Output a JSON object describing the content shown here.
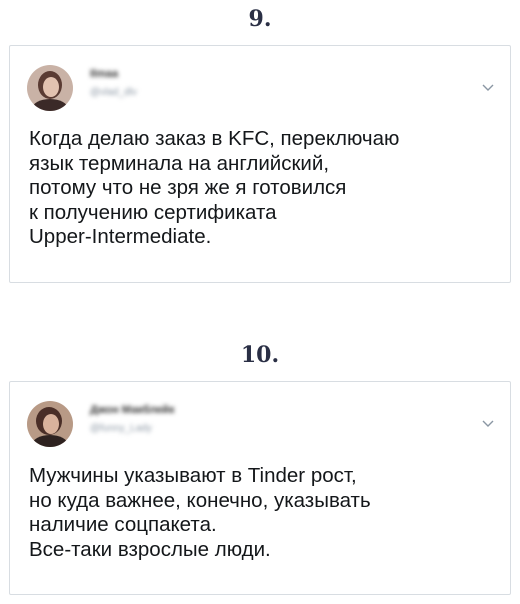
{
  "tweets": [
    {
      "number": "9.",
      "name": "Ilmaa",
      "handle": "@vlad_dlv",
      "lines": [
        "Когда делаю заказ в KFC, переключаю",
        "язык терминала на английский,",
        "потому что не зря же я готовился",
        "к получению сертификата",
        "Upper-Intermediate."
      ]
    },
    {
      "number": "10.",
      "name": "Джон Макблейк",
      "handle": "@funny_Lady",
      "lines": [
        "Мужчины указывают в Tinder рост,",
        "но куда важнее, конечно, указывать",
        "наличие соцпакета.",
        "Все-таки взрослые люди."
      ]
    }
  ],
  "icons": {
    "options": "chevron-down-icon",
    "avatar": "avatar"
  },
  "colors": {
    "border": "#d8dde2",
    "number": "#2a2f45",
    "text": "#14171a",
    "muted": "#8a96a3"
  }
}
